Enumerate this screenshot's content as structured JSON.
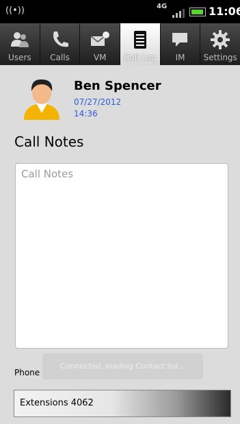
{
  "status_bar": {
    "signal_glyph": "((•))",
    "network": "4G",
    "time": "11:06"
  },
  "tabs": [
    {
      "label": "Users",
      "icon": "users-icon"
    },
    {
      "label": "Calls",
      "icon": "phone-icon"
    },
    {
      "label": "VM",
      "icon": "voicemail-icon"
    },
    {
      "label": "Call Log",
      "icon": "call-log-icon",
      "active": true
    },
    {
      "label": "IM",
      "icon": "chat-icon"
    },
    {
      "label": "Settings",
      "icon": "gear-icon"
    }
  ],
  "contact": {
    "name": "Ben Spencer",
    "date": "07/27/2012",
    "time": "14:36"
  },
  "notes": {
    "title": "Call Notes",
    "placeholder": "Call Notes"
  },
  "phone": {
    "label": "Phone",
    "selected": "Extensions 4062"
  },
  "toast": {
    "text": "Connected, loading Contact list..."
  },
  "colors": {
    "accent_blue": "#2a5bd7",
    "battery_green": "#5bd32e"
  }
}
